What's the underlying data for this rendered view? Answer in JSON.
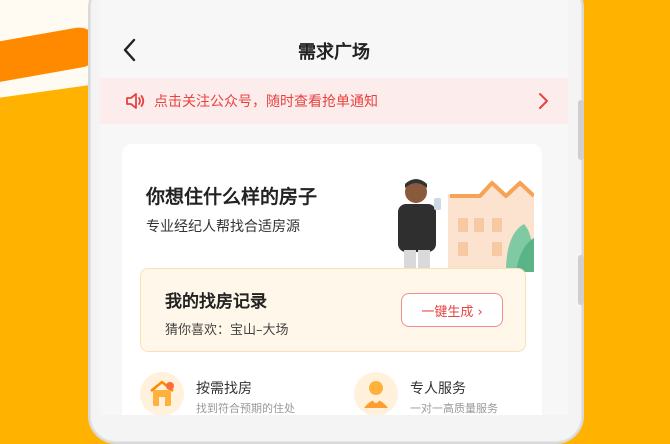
{
  "colors": {
    "background": "#ffb300",
    "accent_red": "#e64340",
    "notice_bg": "#fdecec",
    "record_bg": "#fff8ea"
  },
  "nav": {
    "back_icon": "chevron-left-icon",
    "title": "需求广场"
  },
  "notice": {
    "icon": "speaker-icon",
    "text": "点击关注公众号，随时查看抢单通知",
    "arrow_icon": "chevron-right-icon"
  },
  "hero": {
    "title": "你想住什么样的房子",
    "subtitle": "专业经纪人帮找合适房源"
  },
  "record": {
    "title": "我的找房记录",
    "guess": "猜你喜欢：宝山–大场",
    "button": "一键生成 ›"
  },
  "features": [
    {
      "icon": "house-icon",
      "title": "按需找房",
      "desc": "找到符合预期的住处"
    },
    {
      "icon": "agent-icon",
      "title": "专人服务",
      "desc": "一对一高质量服务"
    }
  ]
}
